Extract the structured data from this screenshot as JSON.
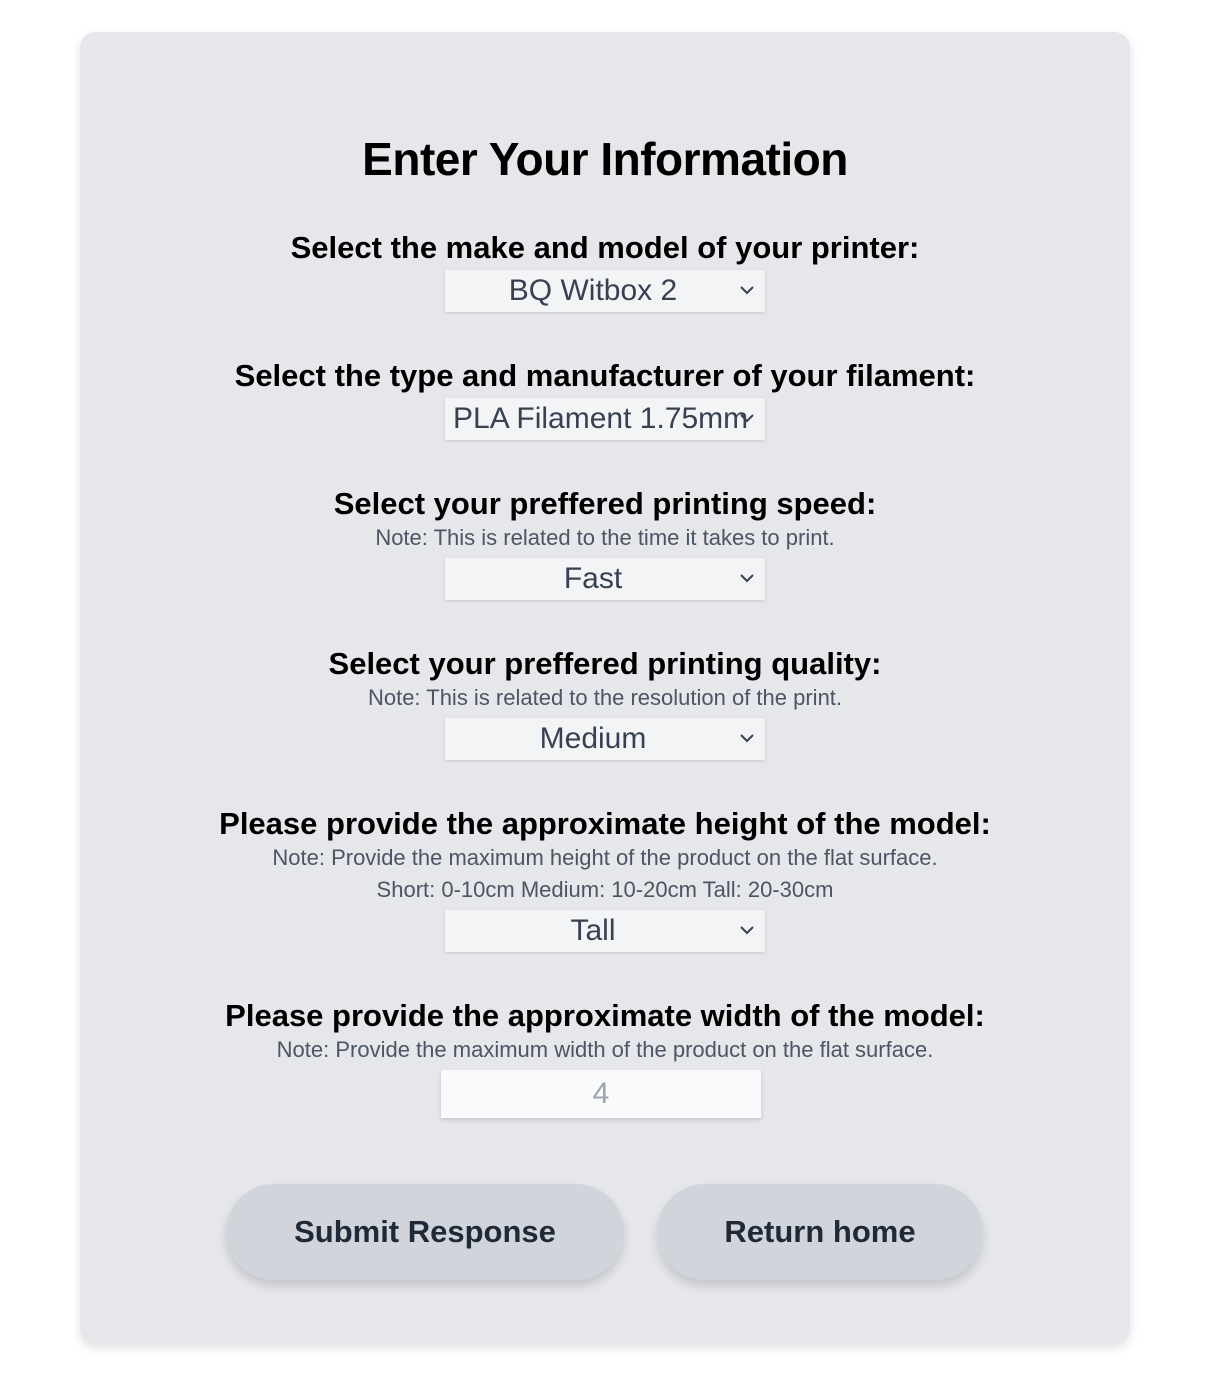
{
  "form": {
    "title": "Enter Your Information",
    "printer": {
      "label": "Select the make and model of your printer:",
      "value": "BQ Witbox 2"
    },
    "filament": {
      "label": "Select the type and manufacturer of your filament:",
      "value": "PLA Filament 1.75mm"
    },
    "speed": {
      "label": "Select your preffered printing speed:",
      "note": "Note: This is related to the time it takes to print.",
      "value": "Fast"
    },
    "quality": {
      "label": "Select your preffered printing quality:",
      "note": "Note: This is related to the resolution of the print.",
      "value": "Medium"
    },
    "height": {
      "label": "Please provide the approximate height of the model:",
      "note": "Note: Provide the maximum height of the product on the flat surface.",
      "note2": "Short: 0-10cm Medium: 10-20cm Tall: 20-30cm",
      "value": "Tall"
    },
    "width": {
      "label": "Please provide the approximate width of the model:",
      "note": "Note: Provide the maximum width of the product on the flat surface.",
      "placeholder": "4"
    },
    "buttons": {
      "submit": "Submit Response",
      "home": "Return home"
    }
  },
  "icons": {
    "select_chevron": "chevron-down-icon"
  },
  "colors": {
    "card_bg": "#e5e7eb",
    "button_bg": "#d1d5db",
    "note_text": "#4b5563"
  }
}
